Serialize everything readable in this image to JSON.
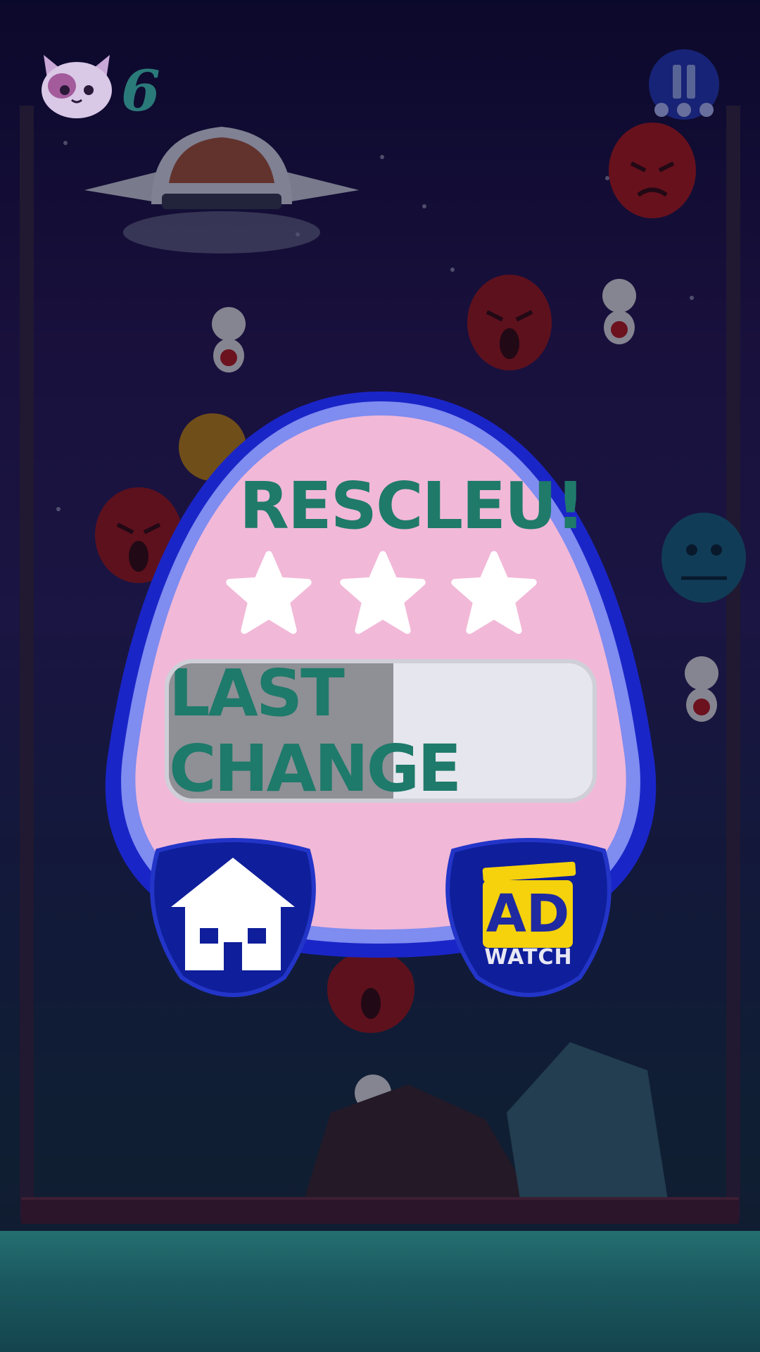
{
  "hud": {
    "score": "6",
    "cat_icon": "cat-head-icon",
    "pause_icon": "pause-icon"
  },
  "dialog": {
    "title": "RESCLEU!",
    "stars": [
      "star-icon",
      "star-icon",
      "star-icon"
    ],
    "progress_button_label": "LAST CHANGE",
    "progress_fraction": 0.53,
    "home_icon": "home-icon",
    "ad_button": {
      "top_text": "AD",
      "bottom_text": "WATCH"
    }
  },
  "colors": {
    "panel_outer": "#1a25c8",
    "panel_inner": "#f2b8d8",
    "title_text": "#1f7a6a",
    "button_blue": "#0f1e9a",
    "ad_yellow": "#f5d20c"
  }
}
